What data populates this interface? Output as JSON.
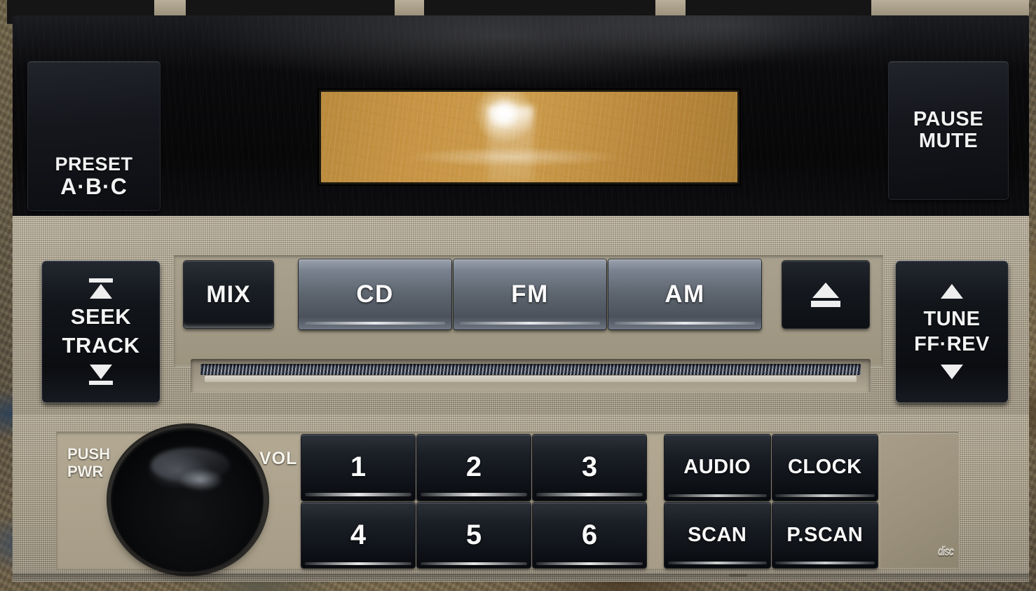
{
  "device": {
    "type": "car-stereo-head-unit",
    "colors": {
      "bezel": "#b6ab93",
      "face": "#0a0a0c",
      "display_amber": "#c29140",
      "button_dark": "#15181e",
      "button_gray": "#5e6670",
      "label_text": "#f4f4f4"
    }
  },
  "top_panel": {
    "preset_button": {
      "line1": "PRESET",
      "line2": "A·B·C"
    },
    "pause_mute_button": {
      "line1": "PAUSE",
      "line2": "MUTE"
    },
    "display": {
      "text": "",
      "state": "glare-obscured",
      "backlight": "amber"
    }
  },
  "middle_panel": {
    "seek_track_button": {
      "line1": "SEEK",
      "line2": "TRACK",
      "up_icon": "seek-up-arrow-icon",
      "down_icon": "seek-down-arrow-icon"
    },
    "mix_button": {
      "label": "MIX"
    },
    "source_buttons": [
      {
        "label": "CD"
      },
      {
        "label": "FM"
      },
      {
        "label": "AM"
      }
    ],
    "eject_button": {
      "icon": "eject-icon",
      "label": ""
    },
    "tune_button": {
      "line1": "TUNE",
      "line2": "FF·REV",
      "up_icon": "triangle-up-icon",
      "down_icon": "triangle-down-icon"
    },
    "cd_slot": {
      "label": ""
    }
  },
  "lower_panel": {
    "volume_knob": {
      "left_label_line1": "PUSH",
      "left_label_line2": "PWR",
      "right_label": "VOL"
    },
    "preset_numbers": [
      "1",
      "2",
      "3",
      "4",
      "5",
      "6"
    ],
    "function_buttons": [
      {
        "label": "AUDIO"
      },
      {
        "label": "CLOCK"
      },
      {
        "label": "SCAN"
      },
      {
        "label": "P.SCAN"
      }
    ],
    "cd_logo": {
      "text": "disc"
    }
  }
}
